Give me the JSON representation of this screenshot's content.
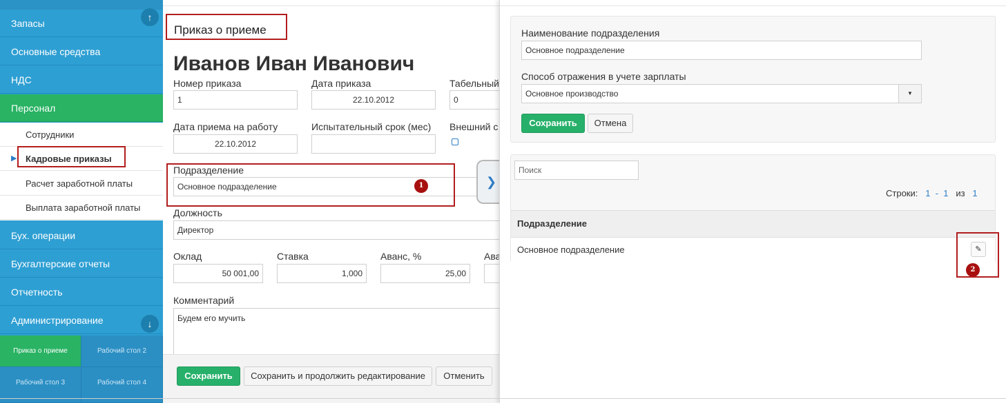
{
  "sidebar": {
    "items": [
      {
        "label": "Запасы"
      },
      {
        "label": "Основные средства"
      },
      {
        "label": "НДС"
      },
      {
        "label": "Персонал"
      },
      {
        "label": "Бух. операции"
      },
      {
        "label": "Бухгалтерские отчеты"
      },
      {
        "label": "Отчетность"
      },
      {
        "label": "Администрирование"
      }
    ],
    "subitems": [
      {
        "label": "Сотрудники"
      },
      {
        "label": "Кадровые приказы"
      },
      {
        "label": "Расчет заработной платы"
      },
      {
        "label": "Выплата заработной платы"
      }
    ],
    "tiles": [
      {
        "label": "Приказ о приеме"
      },
      {
        "label": "Рабочий стол 2"
      },
      {
        "label": "Рабочий стол 3"
      },
      {
        "label": "Рабочий стол 4"
      }
    ],
    "scroll_up_icon": "arrow-up-icon",
    "scroll_down_icon": "arrow-down-icon",
    "active_color": "#29b363",
    "bg_color": "#2e9fd3"
  },
  "form": {
    "title": "Приказ о приеме",
    "person_name": "Иванов Иван Иванович",
    "order_number": {
      "label": "Номер приказа",
      "value": "1"
    },
    "order_date": {
      "label": "Дата приказа",
      "value": "22.10.2012"
    },
    "tab_number": {
      "label": "Табельный",
      "value": "0"
    },
    "hire_date": {
      "label": "Дата приема на работу",
      "value": "22.10.2012"
    },
    "probation": {
      "label": "Испытательный срок (мес)",
      "value": ""
    },
    "external": {
      "label": "Внешний с"
    },
    "department": {
      "label": "Подразделение",
      "value": "Основное подразделение",
      "badge": "1"
    },
    "position": {
      "label": "Должность",
      "value": "Директор"
    },
    "salary": {
      "label": "Оклад",
      "value": "50 001,00"
    },
    "rate": {
      "label": "Ставка",
      "value": "1,000"
    },
    "advance_pct": {
      "label": "Аванс, %",
      "value": "25,00"
    },
    "advance_short": {
      "label": "Ава"
    },
    "comment": {
      "label": "Комментарий",
      "value": "Будем его мучить"
    },
    "buttons": {
      "save": "Сохранить",
      "save_continue": "Сохранить и продолжить редактирование",
      "cancel": "Отменить"
    }
  },
  "toggle": {
    "glyph": "❯"
  },
  "panel": {
    "dept_name": {
      "label": "Наименование подразделения",
      "value": "Основное подразделение"
    },
    "salary_method": {
      "label": "Способ отражения в учете зарплаты",
      "value": "Основное производство",
      "caret": "▼"
    },
    "save": "Сохранить",
    "cancel": "Отмена",
    "search_placeholder": "Поиск",
    "rows": {
      "label": "Строки:",
      "from": "1",
      "dash": "-",
      "to": "1",
      "of": "из",
      "total": "1"
    },
    "table": {
      "header": "Подразделение",
      "rows": [
        {
          "name": "Основное подразделение"
        }
      ]
    },
    "edit_icon": "pencil-icon",
    "badge": "2"
  }
}
